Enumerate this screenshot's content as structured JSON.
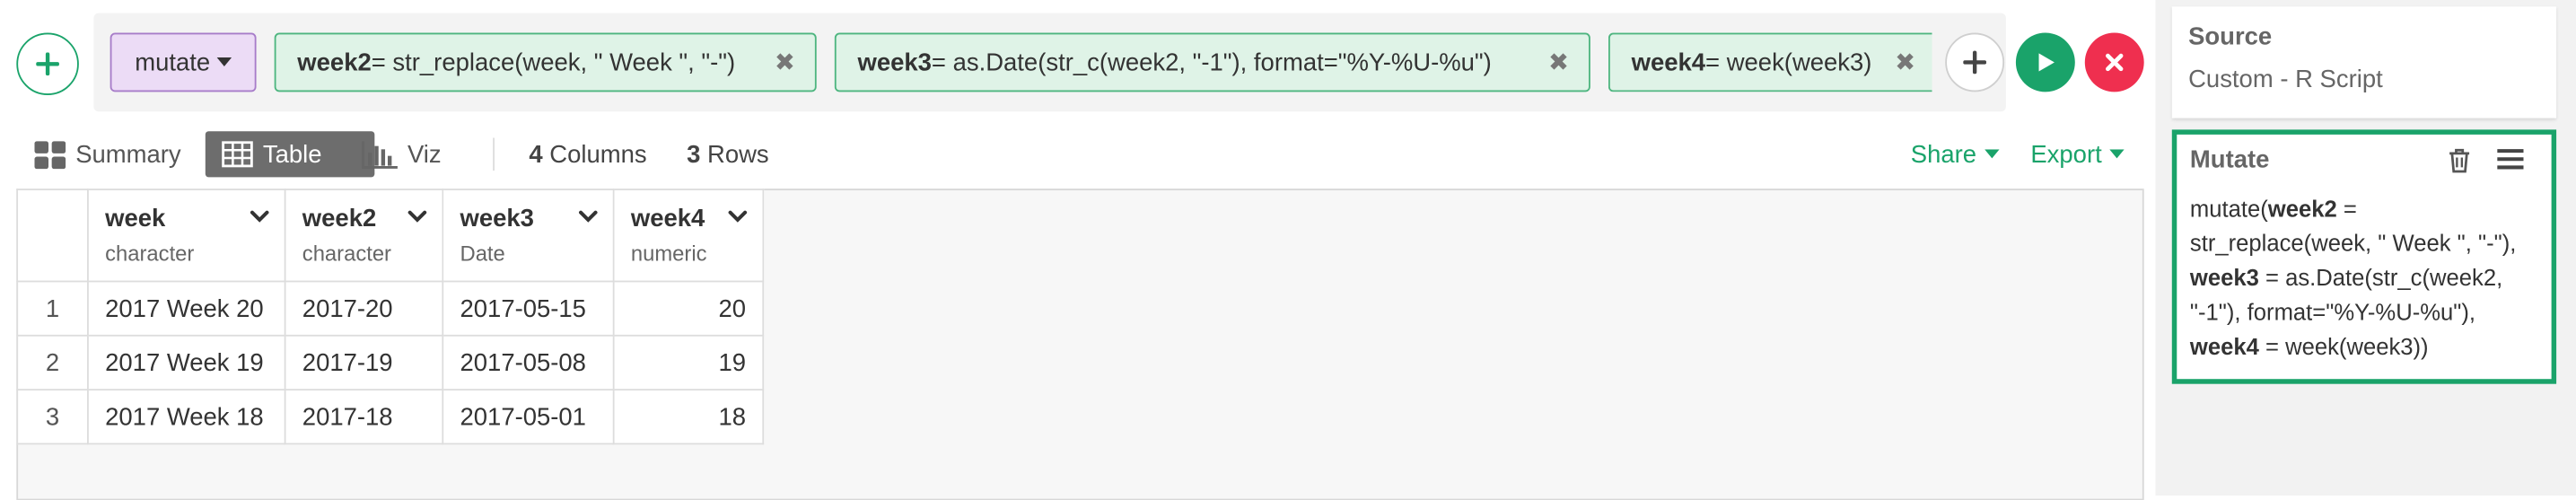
{
  "command_bar": {
    "command": "mutate",
    "chips": [
      {
        "name": "week2",
        "expr": " = str_replace(week, \" Week \", \"-\")"
      },
      {
        "name": "week3",
        "expr": " = as.Date(str_c(week2, \"-1\"), format=\"%Y-%U-%u\")"
      },
      {
        "name": "week4",
        "expr": " = week(week3)"
      }
    ]
  },
  "toolbar": {
    "views": [
      {
        "label": "Summary",
        "icon": "grid-icon"
      },
      {
        "label": "Table",
        "icon": "table-icon",
        "active": true
      },
      {
        "label": "Viz",
        "icon": "bar-chart-icon"
      }
    ],
    "columns_count": "4",
    "columns_label": " Columns",
    "rows_count": "3",
    "rows_label": " Rows",
    "share_label": "Share",
    "export_label": "Export"
  },
  "table": {
    "columns": [
      {
        "name": "week",
        "type": "character"
      },
      {
        "name": "week2",
        "type": "character"
      },
      {
        "name": "week3",
        "type": "Date"
      },
      {
        "name": "week4",
        "type": "numeric"
      }
    ],
    "rows": [
      {
        "n": "1",
        "cells": [
          "2017 Week 20",
          "2017-20",
          "2017-05-15",
          "20"
        ]
      },
      {
        "n": "2",
        "cells": [
          "2017 Week 19",
          "2017-19",
          "2017-05-08",
          "19"
        ]
      },
      {
        "n": "3",
        "cells": [
          "2017 Week 18",
          "2017-18",
          "2017-05-01",
          "18"
        ]
      }
    ]
  },
  "side_panel": {
    "source": {
      "title": "Source",
      "subtitle": "Custom - R Script"
    },
    "mutate": {
      "title": "Mutate",
      "code": {
        "p1": "mutate(",
        "b1": "week2",
        "p2": " = str_replace(week, \" Week \", \"-\"), ",
        "b2": "week3",
        "p3": " = as.Date(str_c(week2, \"-1\"), format=\"%Y-%U-%u\"), ",
        "b3": "week4",
        "p4": " = week(week3))"
      }
    }
  },
  "colors": {
    "accent": "#1aa36a",
    "danger": "#ef2f4f",
    "command": "#ecdcf6",
    "chip": "#dff3e7"
  }
}
